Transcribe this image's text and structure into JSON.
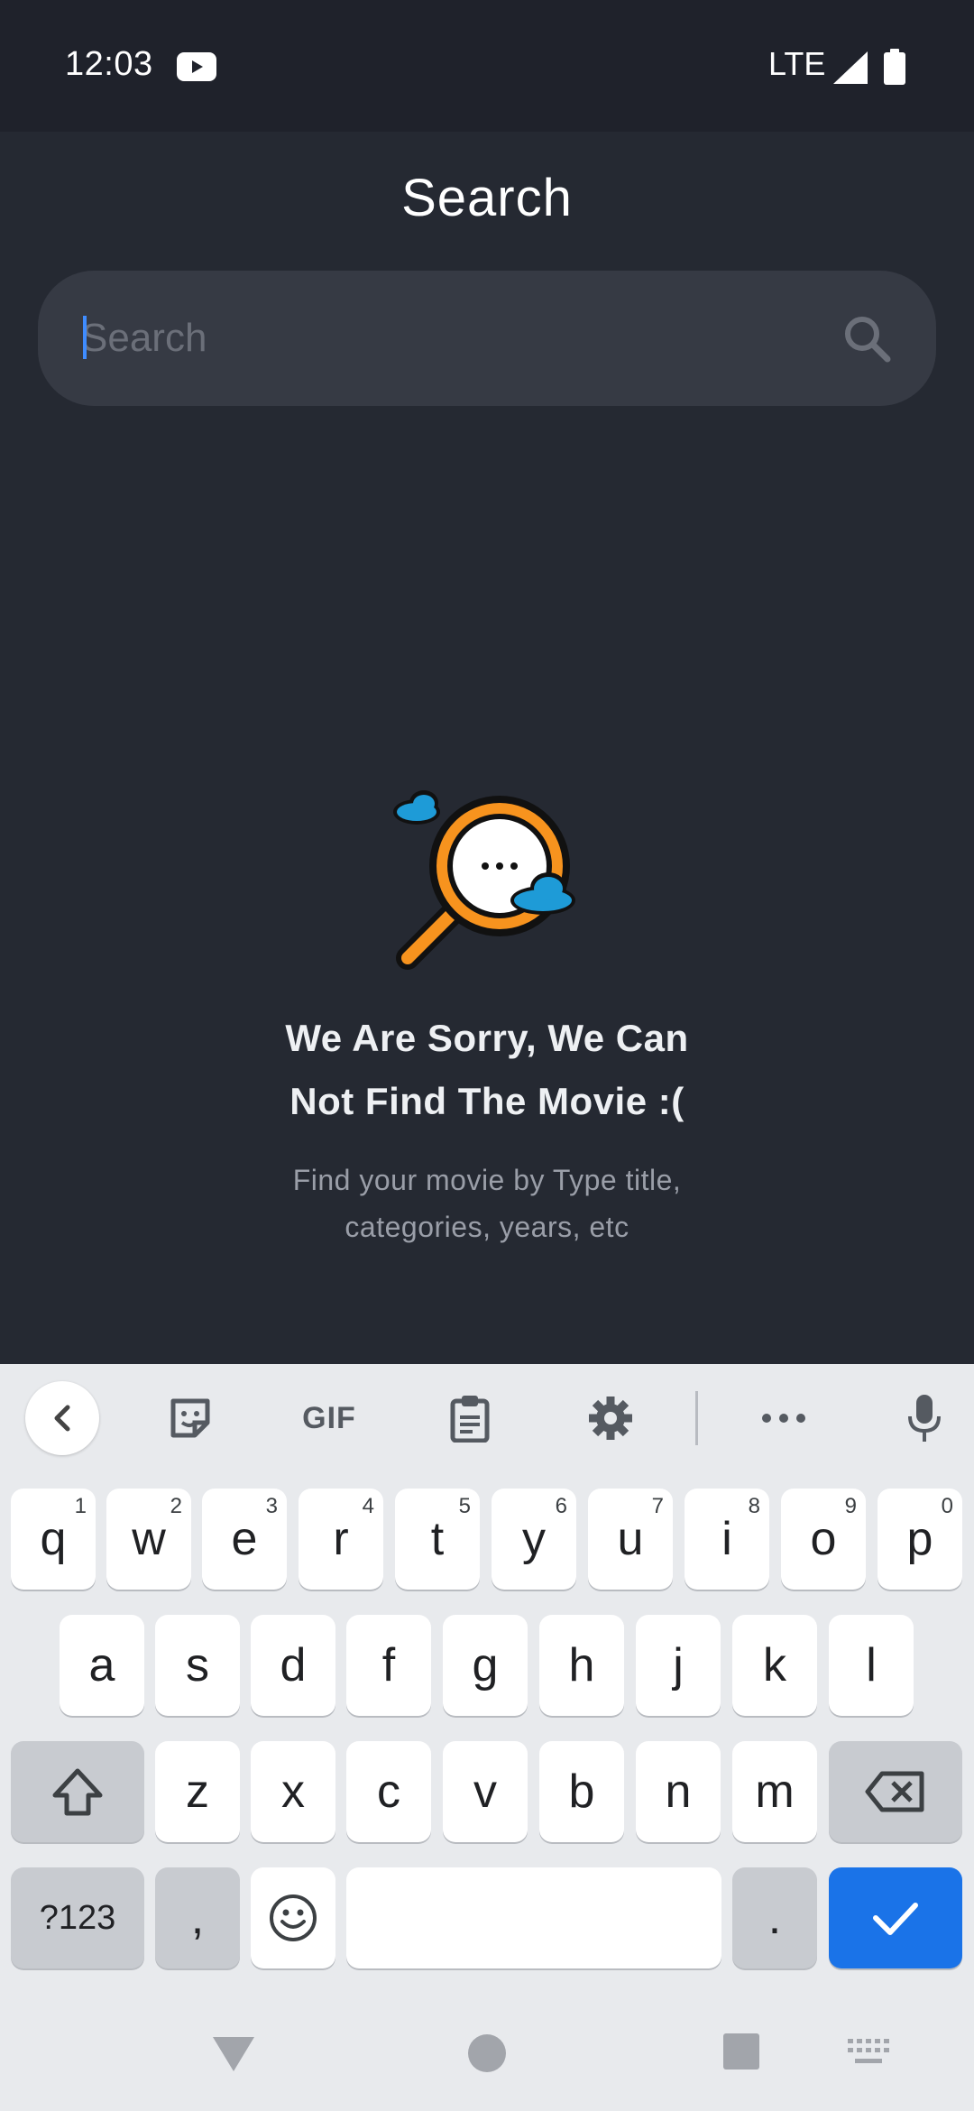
{
  "status_bar": {
    "time": "12:03",
    "network": "LTE",
    "icons": [
      "youtube-icon",
      "signal-icon",
      "battery-icon"
    ]
  },
  "header": {
    "title": "Search"
  },
  "search": {
    "placeholder": "Search",
    "value": ""
  },
  "empty_state": {
    "title_line1": "We Are Sorry, We Can",
    "title_line2": "Not Find The Movie :(",
    "subtitle_line1": "Find your movie by Type title,",
    "subtitle_line2": "categories, years, etc"
  },
  "keyboard": {
    "toolbar": {
      "gif_label": "GIF",
      "icons": [
        "chevron-left-icon",
        "sticker-icon",
        "clipboard-icon",
        "gear-icon",
        "more-icon",
        "microphone-icon"
      ]
    },
    "row1": [
      {
        "key": "q",
        "hint": "1"
      },
      {
        "key": "w",
        "hint": "2"
      },
      {
        "key": "e",
        "hint": "3"
      },
      {
        "key": "r",
        "hint": "4"
      },
      {
        "key": "t",
        "hint": "5"
      },
      {
        "key": "y",
        "hint": "6"
      },
      {
        "key": "u",
        "hint": "7"
      },
      {
        "key": "i",
        "hint": "8"
      },
      {
        "key": "o",
        "hint": "9"
      },
      {
        "key": "p",
        "hint": "0"
      }
    ],
    "row2": [
      "a",
      "s",
      "d",
      "f",
      "g",
      "h",
      "j",
      "k",
      "l"
    ],
    "row3": [
      "z",
      "x",
      "c",
      "v",
      "b",
      "n",
      "m"
    ],
    "symbols_label": "?123",
    "comma": ",",
    "period": "."
  },
  "colors": {
    "background": "#252932",
    "search_box": "#363a44",
    "accent": "#1a73e8",
    "magnifier": "#f7931e",
    "cloud": "#1e9bd7"
  }
}
